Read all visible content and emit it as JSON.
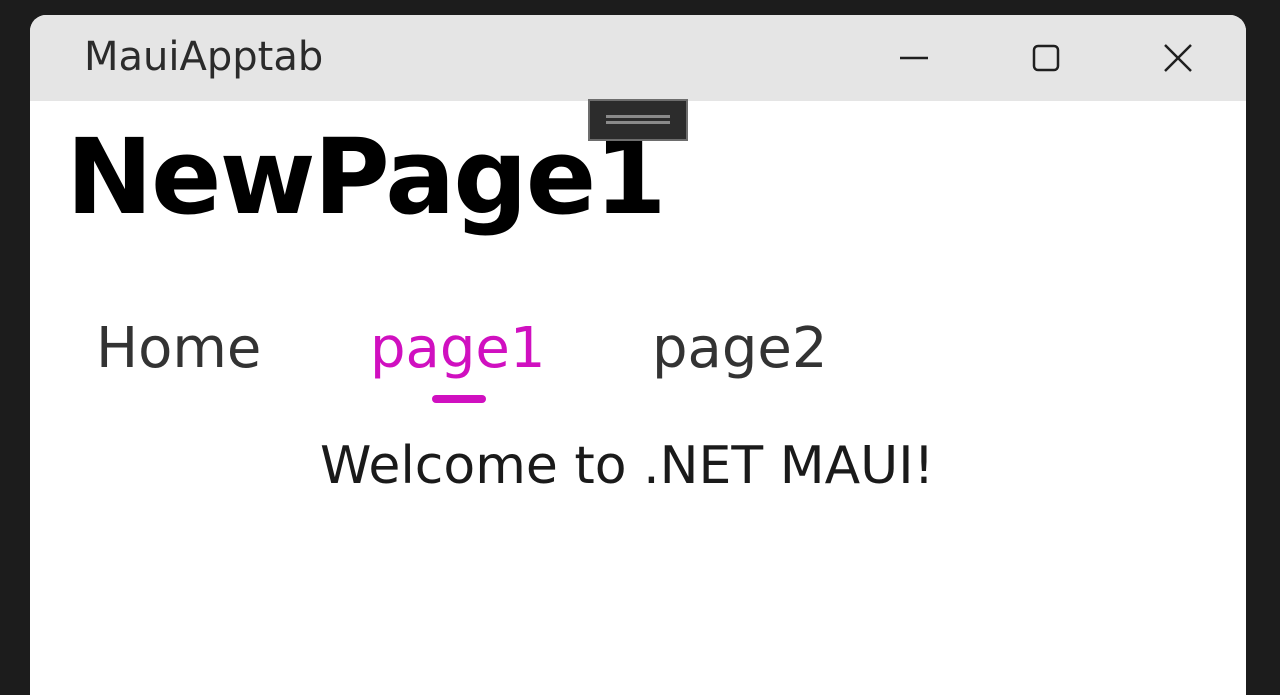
{
  "window": {
    "title": "MauiApptab"
  },
  "titlebar": {
    "controls": [
      {
        "name": "minimize",
        "icon": "minimize-icon"
      },
      {
        "name": "maximize",
        "icon": "maximize-icon"
      },
      {
        "name": "close",
        "icon": "close-icon"
      }
    ]
  },
  "page": {
    "title": "NewPage1",
    "message": "Welcome to .NET MAUI!"
  },
  "tabs": [
    {
      "label": "Home",
      "selected": false
    },
    {
      "label": "page1",
      "selected": true
    },
    {
      "label": "page2",
      "selected": false
    }
  ],
  "colors": {
    "accent": "#d010c0",
    "titlebar": "#e5e5e5",
    "background": "#ffffff",
    "desktop": "#1c1c1c"
  }
}
